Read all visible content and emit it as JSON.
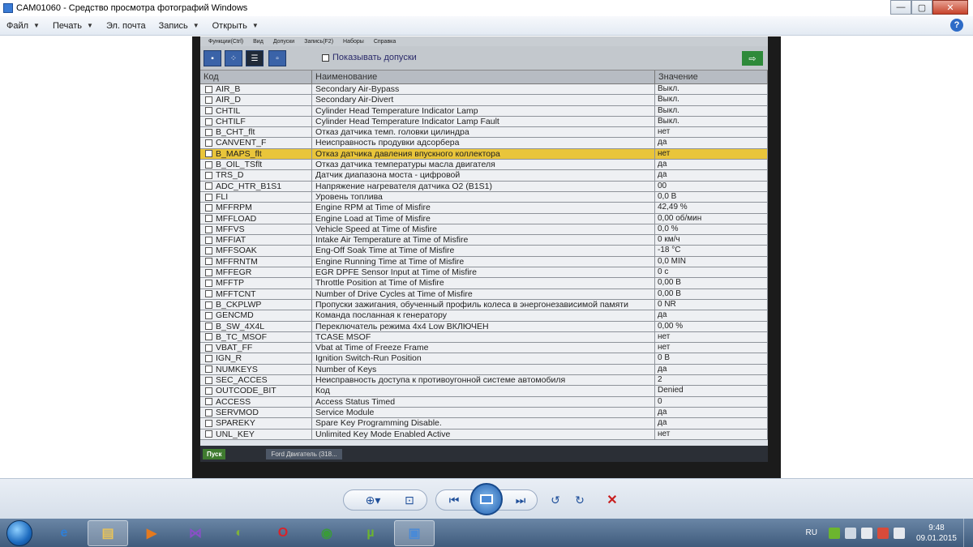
{
  "window": {
    "title": "CAM01060 - Средство просмотра фотографий Windows",
    "controls": {
      "minimize": "—",
      "maximize": "▢",
      "close": "✕"
    }
  },
  "menu": {
    "items": [
      "Файл",
      "Печать",
      "Эл. почта",
      "Запись",
      "Открыть"
    ],
    "help": "?"
  },
  "photo": {
    "inner_menu": [
      "Функции(Ctrl)",
      "Вид",
      "Допуски",
      "Запись(F2)",
      "Наборы",
      "Справка"
    ],
    "show_tolerances_label": "Показывать допуски",
    "columns": {
      "code": "Код",
      "name": "Наименование",
      "value": "Значение"
    },
    "rows": [
      {
        "code": "AIR_B",
        "name": "Secondary Air-Bypass",
        "value": "Выкл."
      },
      {
        "code": "AIR_D",
        "name": "Secondary Air-Divert",
        "value": "Выкл."
      },
      {
        "code": "CHTIL",
        "name": "Cylinder Head Temperature Indicator Lamp",
        "value": "Выкл."
      },
      {
        "code": "CHTILF",
        "name": "Cylinder Head Temperature Indicator Lamp Fault",
        "value": "Выкл."
      },
      {
        "code": "B_CHT_flt",
        "name": "Отказ датчика темп. головки цилиндра",
        "value": "нет"
      },
      {
        "code": "CANVENT_F",
        "name": "Неисправность продувки адсорбера",
        "value": "да"
      },
      {
        "code": "B_MAPS_flt",
        "name": "Отказ датчика давления впускного коллектора",
        "value": "нет"
      },
      {
        "code": "B_OIL_TSflt",
        "name": "Отказ датчика температуры масла двигателя",
        "value": "да"
      },
      {
        "code": "TRS_D",
        "name": "Датчик диапазона моста - цифровой",
        "value": "да"
      },
      {
        "code": "ADC_HTR_B1S1",
        "name": "Напряжение нагревателя датчика О2 (B1S1)",
        "value": "00"
      },
      {
        "code": "FLI",
        "name": "Уровень топлива",
        "value": "0,0 B"
      },
      {
        "code": "MFFRPM",
        "name": "Engine RPM at Time of Misfire",
        "value": "42,49 %"
      },
      {
        "code": "MFFLOAD",
        "name": "Engine Load at Time of Misfire",
        "value": "0,00 об/мин"
      },
      {
        "code": "MFFVS",
        "name": "Vehicle Speed at Time of Misfire",
        "value": "0,0 %"
      },
      {
        "code": "MFFIAT",
        "name": "Intake Air Temperature at Time of Misfire",
        "value": "0 км/ч"
      },
      {
        "code": "MFFSOAK",
        "name": "Eng-Off Soak Time at Time of Misfire",
        "value": "-18 °C"
      },
      {
        "code": "MFFRNTM",
        "name": "Engine Running Time at Time of Misfire",
        "value": "0,0 MIN"
      },
      {
        "code": "MFFEGR",
        "name": "EGR DPFE Sensor Input at Time of Misfire",
        "value": "0 с"
      },
      {
        "code": "MFFTP",
        "name": "Throttle Position at Time of Misfire",
        "value": "0,00 B"
      },
      {
        "code": "MFFTCNT",
        "name": "Number of Drive Cycles at Time of Misfire",
        "value": "0,00 B"
      },
      {
        "code": "B_CKPLWP",
        "name": "Пропуски зажигания, обученный профиль колеса в энергонезависимой памяти",
        "value": "0 NR"
      },
      {
        "code": "GENCMD",
        "name": "Команда посланная к генератору",
        "value": "да"
      },
      {
        "code": "B_SW_4X4L",
        "name": "Переключатель режима 4x4 Low ВКЛЮЧЕН",
        "value": "0,00 %"
      },
      {
        "code": "B_TC_MSOF",
        "name": "TCASE MSOF",
        "value": "нет"
      },
      {
        "code": "VBAT_FF",
        "name": "Vbat at Time of Freeze Frame",
        "value": "нет"
      },
      {
        "code": "IGN_R",
        "name": "Ignition Switch-Run Position",
        "value": "0 B"
      },
      {
        "code": "NUMKEYS",
        "name": "Number of Keys",
        "value": "да"
      },
      {
        "code": "SEC_ACCES",
        "name": "Неисправность доступа к противоугонной системе автомобиля",
        "value": "2"
      },
      {
        "code": "OUTCODE_BIT",
        "name": "Код",
        "value": "Denied"
      },
      {
        "code": "ACCESS",
        "name": "Access Status Timed",
        "value": "0"
      },
      {
        "code": "SERVMOD",
        "name": "Service Module",
        "value": "да"
      },
      {
        "code": "SPAREKY",
        "name": "Spare Key Programming Disable.",
        "value": "да"
      },
      {
        "code": "UNL_KEY",
        "name": "Unlimited Key Mode Enabled Active",
        "value": "нет"
      }
    ],
    "highlighted_row": 6,
    "inner_taskbar": {
      "start": "Пуск",
      "task": "Ford Двигатель (318..."
    }
  },
  "viewer_controls": {
    "zoom": "⊕▾",
    "fit": "⊡",
    "prev": "⏮",
    "next": "⏭",
    "rotate_ccw": "↺",
    "rotate_cw": "↻",
    "delete": "✕"
  },
  "taskbar": {
    "apps": [
      {
        "name": "ie",
        "glyph": "e",
        "color": "#2f7fd6",
        "active": false
      },
      {
        "name": "explorer",
        "glyph": "▤",
        "color": "#e7c35a",
        "active": true
      },
      {
        "name": "media",
        "glyph": "▶",
        "color": "#e57a1e",
        "active": false
      },
      {
        "name": "vs",
        "glyph": "⋈",
        "color": "#8a4fc7",
        "active": false
      },
      {
        "name": "stripes",
        "glyph": "◐",
        "color": "#7fb13a",
        "active": false
      },
      {
        "name": "opera",
        "glyph": "O",
        "color": "#d8232a",
        "active": false
      },
      {
        "name": "chrome",
        "glyph": "◉",
        "color": "#3a9a3a",
        "active": false
      },
      {
        "name": "utorrent",
        "glyph": "µ",
        "color": "#6cb52e",
        "active": false
      },
      {
        "name": "photo-viewer",
        "glyph": "▣",
        "color": "#4a8ad6",
        "active": true
      }
    ],
    "language": "RU",
    "time": "9:48",
    "date": "09.01.2015"
  }
}
